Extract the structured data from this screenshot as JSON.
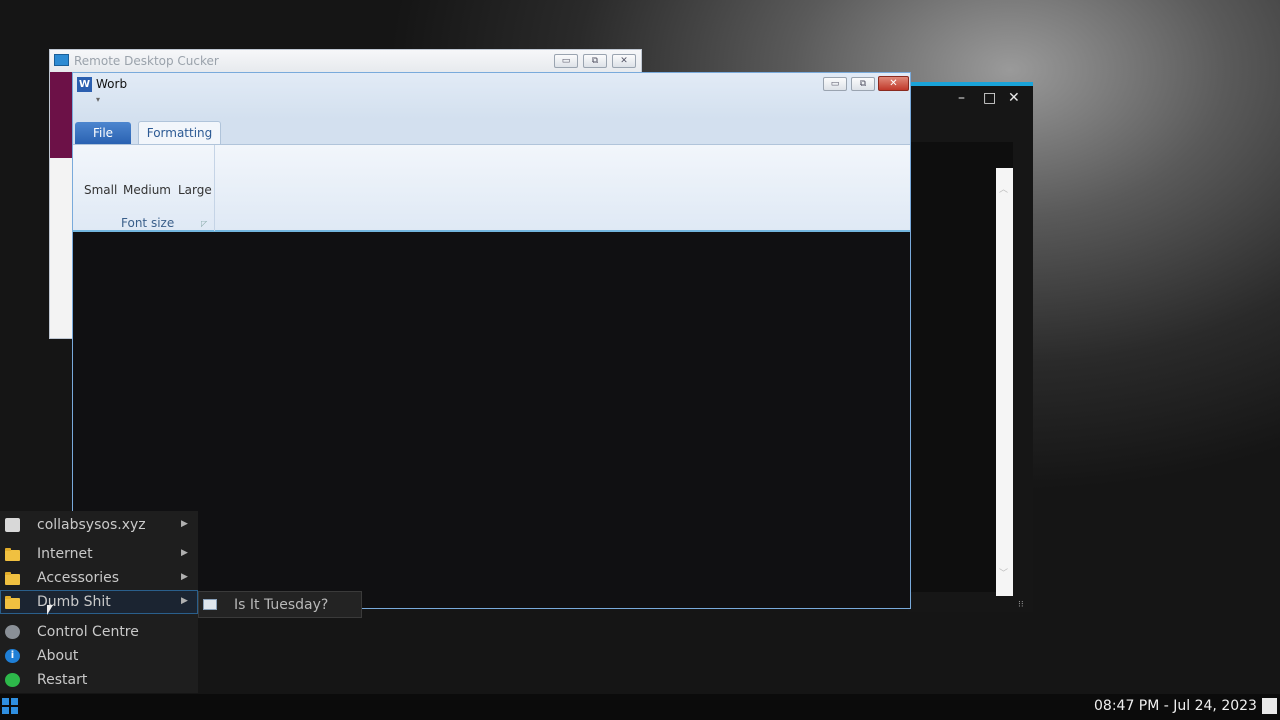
{
  "remote_desktop": {
    "title": "Remote Desktop Cucker",
    "minimize": "▭",
    "restore": "⧉",
    "close": "✕"
  },
  "dark_window": {
    "minimize": "–",
    "maximize": "□",
    "close": "✕",
    "scroll_up": "︿",
    "scroll_down": "﹀",
    "grip": "⁝⁝"
  },
  "worb": {
    "title": "Worb",
    "icon_letter": "W",
    "quick_access": "▾",
    "minimize": "▭",
    "restore": "⧉",
    "close": "✕",
    "tabs": {
      "file": "File",
      "formatting": "Formatting"
    },
    "font_size_group": {
      "label": "Font size",
      "small": "Small",
      "medium": "Medium",
      "large": "Large",
      "launcher": "◸"
    }
  },
  "start_menu": {
    "items": [
      {
        "label": "collabsysos.xyz",
        "icon": "user-icon",
        "has_submenu": true
      },
      {
        "label": "Internet",
        "icon": "folder-icon",
        "has_submenu": true
      },
      {
        "label": "Accessories",
        "icon": "folder-icon",
        "has_submenu": true
      },
      {
        "label": "Dumb Shit",
        "icon": "folder-icon",
        "has_submenu": true,
        "highlighted": true
      },
      {
        "label": "Control Centre",
        "icon": "gear-icon"
      },
      {
        "label": "About",
        "icon": "info-icon"
      },
      {
        "label": "Restart",
        "icon": "restart-icon"
      }
    ],
    "submenu": {
      "label": "Is It Tuesday?",
      "icon": "window-app-icon"
    },
    "arrow": "▶"
  },
  "taskbar": {
    "clock": "08:47 PM - Jul 24, 2023"
  },
  "colors": {
    "accent": "#1aa3d8",
    "file_tab": "#2a62b2",
    "close_red": "#c0392b"
  }
}
